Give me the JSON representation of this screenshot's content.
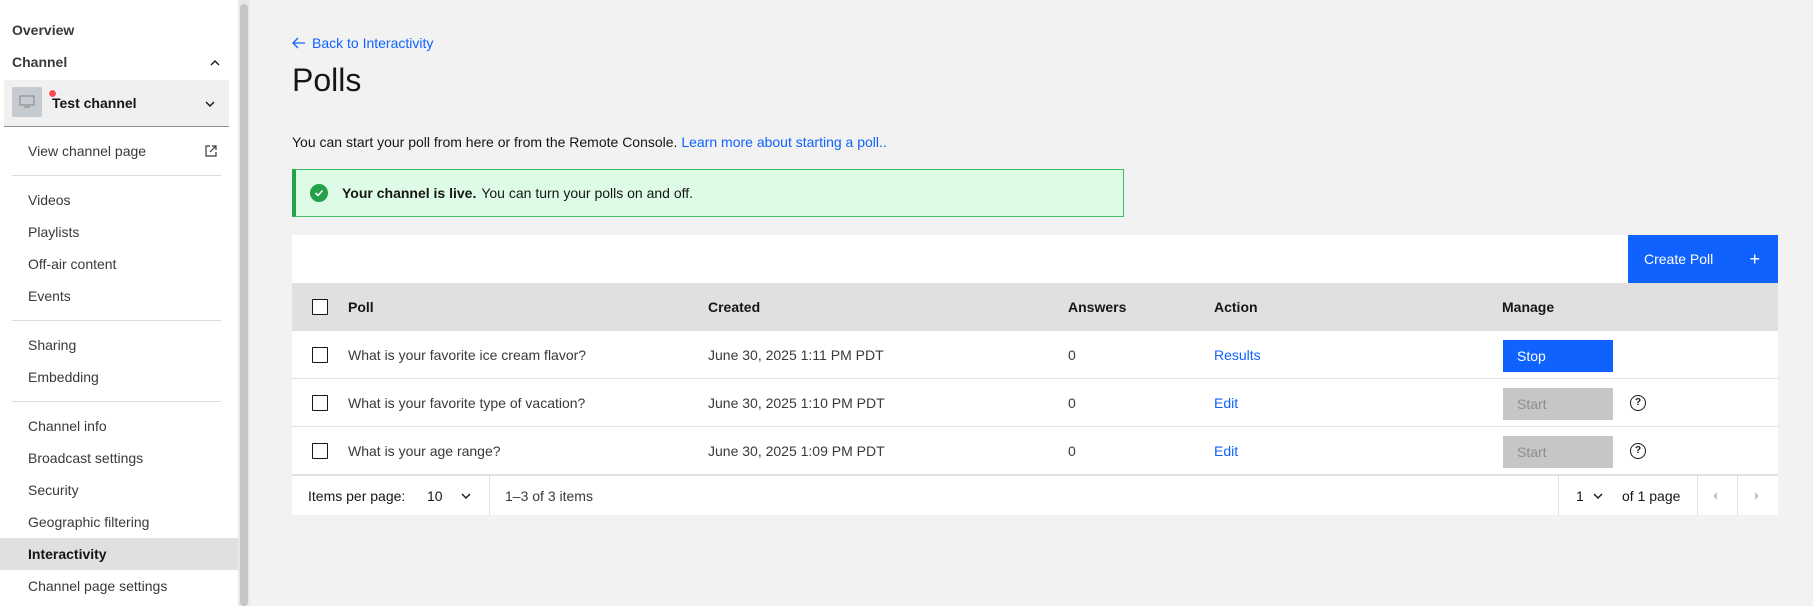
{
  "sidebar": {
    "overview": "Overview",
    "channel_heading": "Channel",
    "channel_name": "Test channel",
    "view_channel_page": "View channel page",
    "group1": [
      "Videos",
      "Playlists",
      "Off-air content",
      "Events"
    ],
    "group2": [
      "Sharing",
      "Embedding"
    ],
    "group3": [
      "Channel info",
      "Broadcast settings",
      "Security",
      "Geographic filtering",
      "Interactivity",
      "Channel page settings"
    ],
    "active_item": "Interactivity"
  },
  "main": {
    "back_link": "Back to Interactivity",
    "title": "Polls",
    "intro_text": "You can start your poll from here or from the Remote Console.",
    "intro_link": "Learn more about starting a poll..",
    "notice_bold": "Your channel is live.",
    "notice_text": "You can turn your polls on and off.",
    "create_button": "Create Poll",
    "create_icon": "+"
  },
  "table": {
    "headers": [
      "Poll",
      "Created",
      "Answers",
      "Action",
      "Manage"
    ],
    "rows": [
      {
        "poll": "What is your favorite ice cream flavor?",
        "created": "June 30, 2025 1:11 PM PDT",
        "answers": "0",
        "action": "Results",
        "manage": "Stop",
        "manage_enabled": true
      },
      {
        "poll": "What is your favorite type of vacation?",
        "created": "June 30, 2025 1:10 PM PDT",
        "answers": "0",
        "action": "Edit",
        "manage": "Start",
        "manage_enabled": false
      },
      {
        "poll": "What is your age range?",
        "created": "June 30, 2025 1:09 PM PDT",
        "answers": "0",
        "action": "Edit",
        "manage": "Start",
        "manage_enabled": false
      }
    ]
  },
  "pagination": {
    "items_per_page_label": "Items per page:",
    "items_per_page_value": "10",
    "range_text": "1–3 of 3 items",
    "page_value": "1",
    "page_total_text": "of 1 page"
  },
  "colors": {
    "accent": "#0f62fe",
    "success": "#24a148",
    "success_bg": "#defbe6",
    "live_dot": "#fa4d56"
  }
}
